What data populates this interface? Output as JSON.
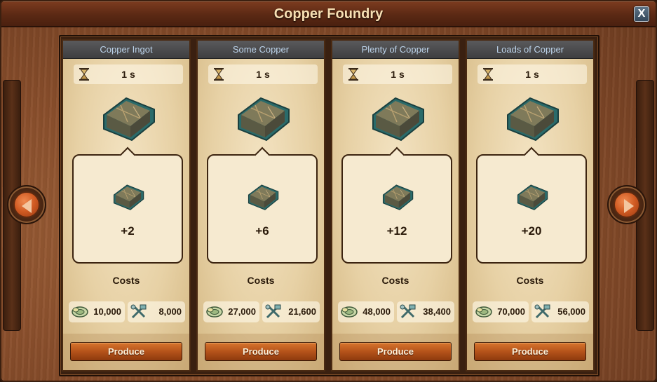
{
  "window": {
    "title": "Copper Foundry",
    "close_label": "X"
  },
  "options": [
    {
      "name": "Copper Ingot",
      "time": "1 s",
      "reward": "+2",
      "costs_label": "Costs",
      "coins": "10,000",
      "supplies": "8,000",
      "button": "Produce"
    },
    {
      "name": "Some Copper",
      "time": "1 s",
      "reward": "+6",
      "costs_label": "Costs",
      "coins": "27,000",
      "supplies": "21,600",
      "button": "Produce"
    },
    {
      "name": "Plenty of Copper",
      "time": "1 s",
      "reward": "+12",
      "costs_label": "Costs",
      "coins": "48,000",
      "supplies": "38,400",
      "button": "Produce"
    },
    {
      "name": "Loads of Copper",
      "time": "1 s",
      "reward": "+20",
      "costs_label": "Costs",
      "coins": "70,000",
      "supplies": "56,000",
      "button": "Produce"
    }
  ],
  "icons": {
    "time": "hourglass-icon",
    "product": "copper-ingot-icon",
    "coins": "coins-icon",
    "supplies": "supplies-icon",
    "prev": "arrow-left-icon",
    "next": "arrow-right-icon"
  },
  "colors": {
    "header_text": "#bcd3ea",
    "title_text": "#f7dfb3",
    "button": "#b5531a"
  }
}
